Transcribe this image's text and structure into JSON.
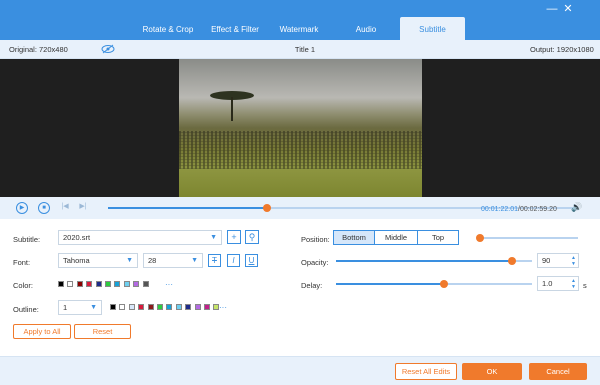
{
  "tabs": [
    {
      "label": "Rotate & Crop",
      "active": false
    },
    {
      "label": "Effect & Filter",
      "active": false
    },
    {
      "label": "Watermark",
      "active": false
    },
    {
      "label": "Audio",
      "active": false
    },
    {
      "label": "Subtitle",
      "active": true
    }
  ],
  "window": {
    "minimize_icon": "minimize-icon",
    "close_icon": "close-icon"
  },
  "infobar": {
    "original": "Original: 720x480",
    "title": "Title 1",
    "output": "Output: 1920x1080",
    "eye_icon": "eye-off-icon"
  },
  "player": {
    "play_icon": "play-icon",
    "stop_icon": "stop-icon",
    "prev_icon": "previous-frame-icon",
    "next_icon": "next-frame-icon",
    "progress_fraction": 0.34,
    "current_time": "00:01:22.01",
    "separator": "/",
    "total_time": "00:02:59.20",
    "volume_icon": "volume-icon"
  },
  "subtitle": {
    "label": "Subtitle:",
    "file": "2020.srt",
    "add_icon": "plus-icon",
    "search_icon": "search-icon"
  },
  "font": {
    "label": "Font:",
    "family": "Tahoma",
    "size": "28",
    "strike_label": "T",
    "italic_label": "I",
    "underline_label": "U"
  },
  "color": {
    "label": "Color:",
    "swatches": [
      "#000000",
      "#ffffff",
      "#8b0000",
      "#d81b3c",
      "#1e2b8a",
      "#2ecc40",
      "#17a2d8",
      "#6fd0f0",
      "#b36ae2",
      "#555555"
    ],
    "more": "···"
  },
  "outline": {
    "label": "Outline:",
    "value": "1",
    "swatches": [
      "#000000",
      "#ffffff",
      "#d8e8fa",
      "#d81b3c",
      "#8b1a1a",
      "#2ecc40",
      "#17a2d8",
      "#6fd0f0",
      "#1e2b8a",
      "#b36ae2",
      "#c21f8a",
      "#c8e66a"
    ],
    "more": "···"
  },
  "actions": {
    "apply_all": "Apply to All",
    "reset": "Reset"
  },
  "position": {
    "label": "Position:",
    "options": [
      "Bottom",
      "Middle",
      "Top"
    ],
    "selected": "Bottom",
    "slider_fraction": 0.02
  },
  "opacity": {
    "label": "Opacity:",
    "value": "90",
    "slider_fraction": 0.9
  },
  "delay": {
    "label": "Delay:",
    "value": "1.0",
    "unit": "s",
    "slider_fraction": 0.55
  },
  "footer": {
    "reset_all": "Reset All Edits",
    "ok": "OK",
    "cancel": "Cancel"
  }
}
